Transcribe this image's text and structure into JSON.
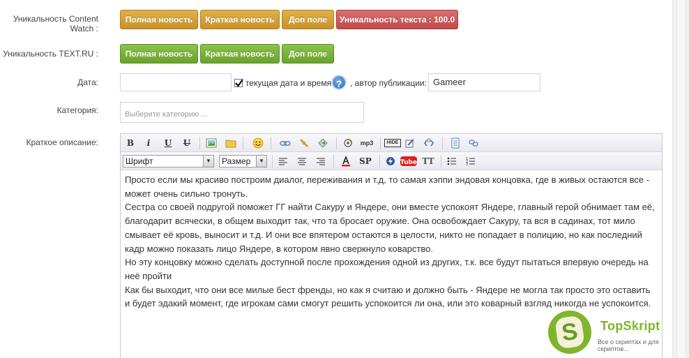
{
  "labels": {
    "content_watch": "Уникальность Content Watch :",
    "text_ru": "Уникальность TEXT.RU :",
    "date": "Дата:",
    "category": "Категория:",
    "short_desc": "Краткое описание:"
  },
  "content_watch_buttons": {
    "full": "Полная новость",
    "short": "Краткая новость",
    "extra": "Доп поле",
    "uniqueness": "Уникальность текста : 100.0"
  },
  "text_ru_buttons": {
    "full": "Полная новость",
    "short": "Краткая новость",
    "extra": "Доп поле"
  },
  "date_row": {
    "date_value": "",
    "checkbox_label": "текущая дата и время",
    "checkbox_checked": true,
    "help_symbol": "?",
    "author_label": ", автор публикации:",
    "author_value": "Gameer"
  },
  "category": {
    "placeholder": "Выберите категорию ..."
  },
  "editor": {
    "toolbar_row1": [
      "bold-icon",
      "italic-icon",
      "underline-icon",
      "strikethrough-icon",
      "image-icon",
      "folder-icon",
      "smiley-icon",
      "link-icon",
      "unlink-icon",
      "leech-icon",
      "media-icon",
      "mp3-icon",
      "hide-icon",
      "quote-icon",
      "code-icon",
      "page-break-icon",
      "page-link-icon"
    ],
    "labels": {
      "bold": "B",
      "italic": "i",
      "underline": "U",
      "strike": "U",
      "mp3": "mp3",
      "hide": "HIDE",
      "sp": "SP",
      "tt": "TT"
    },
    "font_select": "Шрифт",
    "size_select": "Размер",
    "paragraphs": [
      "Просто если мы красиво построим диалог, переживания и т.д, то самая хэппи эндовая концовка, где в живых остаются все - может очень сильно тронуть.",
      "Сестра со своей подругой поможет ГГ найти Сакуру и Яндере, они вместе успокоят Яндере, главный герой обнимает там её, благодарит всячески, в общем выходит так, что та бросает оружие. Она освобождает Сакуру, та вся в садинах, тот мило смывает её кровь, выносит и т.д. И они все впятером остаются в целости, никто не попадает в полицию, но как последний кадр можно показать лицо Яндере, в котором явно сверкнуло коварство.",
      "Но эту концовку можно сделать доступной после прохождения одной из других, т.к. все будут пытаться впервую очередь на неё пройти",
      "Как бы выходит, что они все милые бест френды, но как я считаю и должно быть - Яндере не могла так просто это оставить и будет эдакий момент, где игрокам сами смогут решить успокоится ли она, или это коварный взгляд никогда не успокоится."
    ]
  },
  "watermark": {
    "letter": "S",
    "title": "TopSkript",
    "subtitle": "Все о скриптах и для скриптов..."
  },
  "colors": {
    "orange": "#d4a03a",
    "red": "#c75a5a",
    "green": "#78b13a",
    "logo": "#7fb52b"
  }
}
